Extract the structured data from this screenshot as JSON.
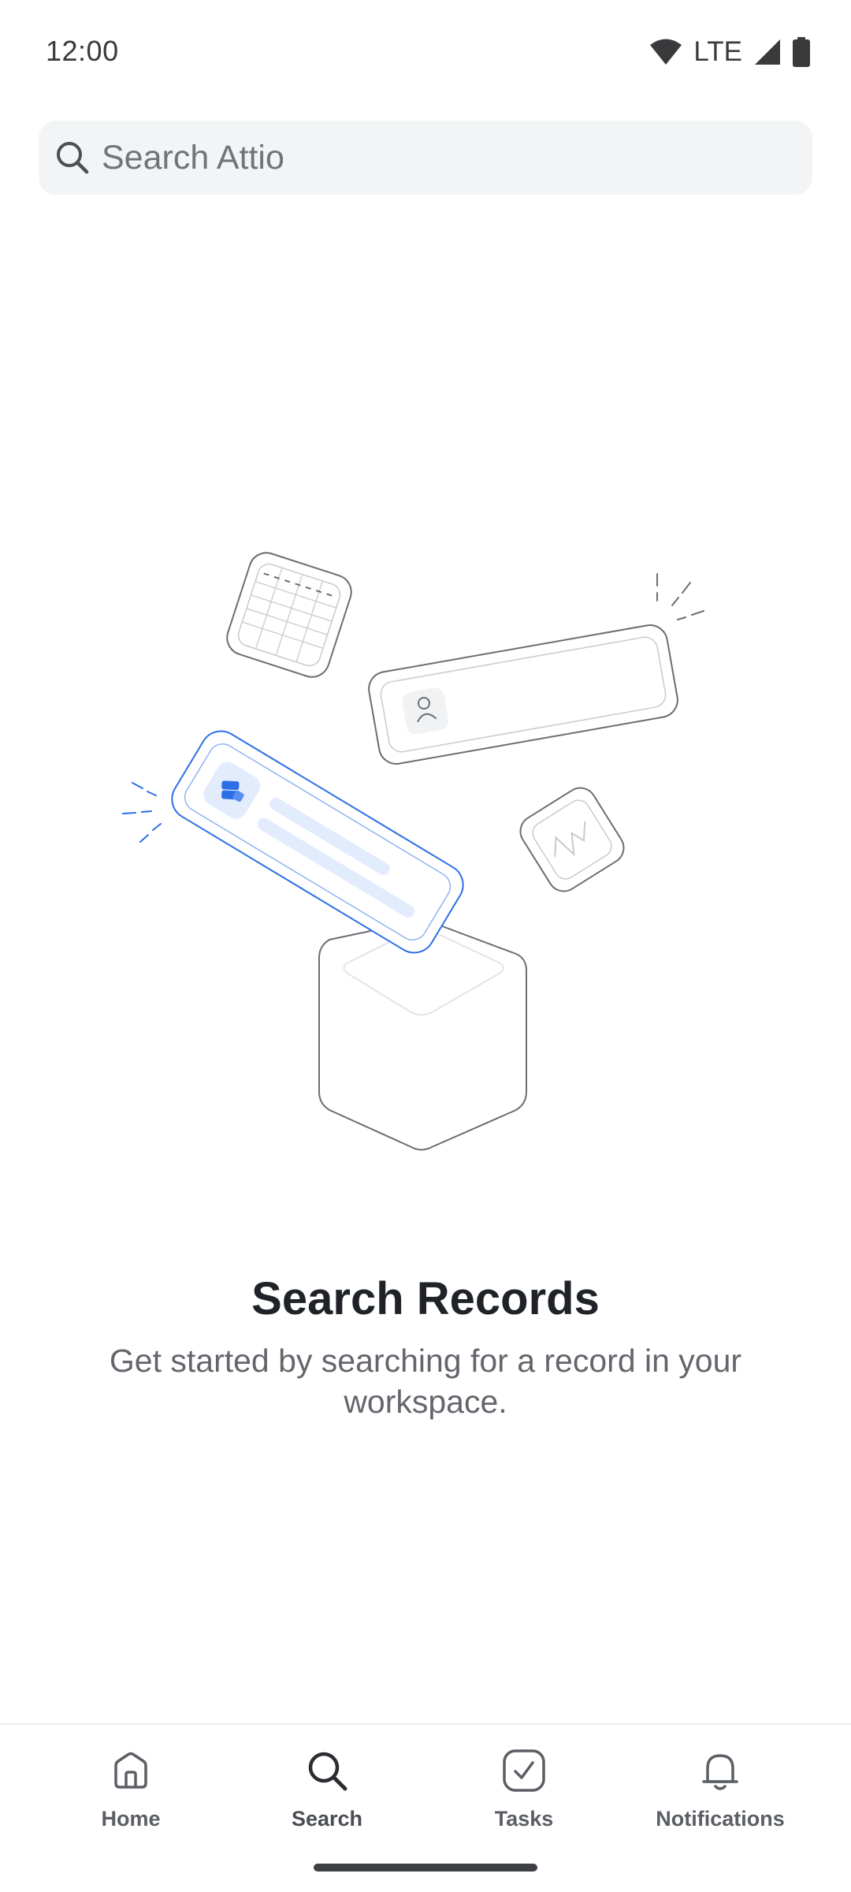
{
  "status_bar": {
    "time": "12:00",
    "network": "LTE",
    "icons": [
      "wifi-icon",
      "cell-signal-icon",
      "battery-icon"
    ]
  },
  "search": {
    "placeholder": "Search Attio",
    "value": "",
    "icon": "search-icon"
  },
  "empty_state": {
    "title": "Search Records",
    "description": "Get started by searching for a record in your workspace."
  },
  "bottom_nav": {
    "items": [
      {
        "label": "Home",
        "icon": "home-icon",
        "active": false
      },
      {
        "label": "Search",
        "icon": "search-icon",
        "active": true
      },
      {
        "label": "Tasks",
        "icon": "task-check-icon",
        "active": false
      },
      {
        "label": "Notifications",
        "icon": "bell-icon",
        "active": false
      }
    ]
  },
  "colors": {
    "accent": "#2c6ee6",
    "accent_light": "#e3ecfd",
    "text_primary": "#1f2328",
    "text_secondary": "#63666c",
    "search_bg": "#f3f4f6",
    "illustration_stroke": "#6b6d72"
  }
}
